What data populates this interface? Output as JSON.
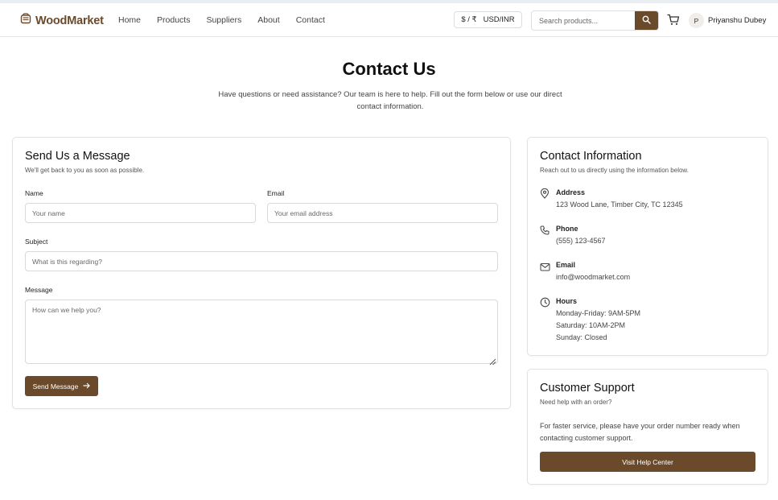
{
  "brand": {
    "name": "WoodMarket",
    "color": "#6b4a2b"
  },
  "nav": {
    "items": [
      "Home",
      "Products",
      "Suppliers",
      "About",
      "Contact"
    ]
  },
  "currency": {
    "symbols": "$ / ₹",
    "label": "USD/INR"
  },
  "search": {
    "placeholder": "Search products..."
  },
  "user": {
    "initial": "P",
    "name": "Priyanshu Dubey"
  },
  "page": {
    "title": "Contact Us",
    "intro": "Have questions or need assistance? Our team is here to help. Fill out the form below or use our direct contact information."
  },
  "form": {
    "title": "Send Us a Message",
    "subtitle": "We'll get back to you as soon as possible.",
    "name_label": "Name",
    "name_placeholder": "Your name",
    "email_label": "Email",
    "email_placeholder": "Your email address",
    "subject_label": "Subject",
    "subject_placeholder": "What is this regarding?",
    "message_label": "Message",
    "message_placeholder": "How can we help you?",
    "submit_label": "Send Message"
  },
  "contact_info": {
    "title": "Contact Information",
    "subtitle": "Reach out to us directly using the information below.",
    "address_label": "Address",
    "address": "123 Wood Lane, Timber City, TC 12345",
    "phone_label": "Phone",
    "phone": "(555) 123-4567",
    "email_label": "Email",
    "email": "info@woodmarket.com",
    "hours_label": "Hours",
    "hours": [
      "Monday-Friday: 9AM-5PM",
      "Saturday: 10AM-2PM",
      "Sunday: Closed"
    ]
  },
  "support": {
    "title": "Customer Support",
    "subtitle": "Need help with an order?",
    "text": "For faster service, please have your order number ready when contacting customer support.",
    "button_label": "Visit Help Center"
  }
}
